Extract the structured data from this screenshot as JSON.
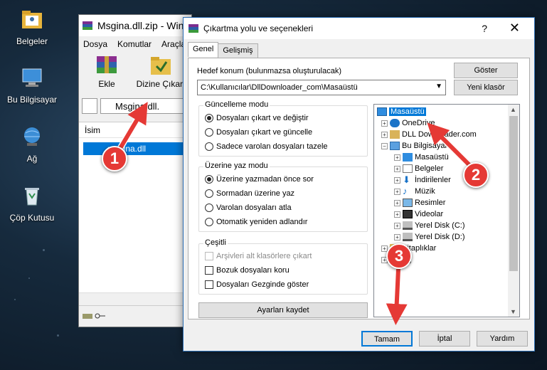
{
  "desktop": {
    "icons": [
      {
        "label": "Belgeler",
        "icon": "folder-documents-icon"
      },
      {
        "label": "Bu Bilgisayar",
        "icon": "computer-icon"
      },
      {
        "label": "Ağ",
        "icon": "network-icon"
      },
      {
        "label": "Çöp Kutusu",
        "icon": "recycle-bin-icon"
      }
    ]
  },
  "winrar": {
    "title": "Msgina.dll.zip - Win",
    "menu": [
      "Dosya",
      "Komutlar",
      "Araçla"
    ],
    "tools": [
      "Ekle",
      "Dizine Çıkart"
    ],
    "address": "Msgina.dll.",
    "column_name": "İsim",
    "file": "msgina.dll"
  },
  "dialog": {
    "title": "Çıkartma yolu ve seçenekleri",
    "help": "?",
    "close": "✕",
    "tabs": [
      "Genel",
      "Gelişmiş"
    ],
    "dest_label": "Hedef konum (bulunmazsa oluşturulacak)",
    "dest_value": "C:\\Kullanıcılar\\DllDownloader_com\\Masaüstü",
    "show_button": "Göster",
    "new_folder_button": "Yeni klasör",
    "update_mode": {
      "title": "Güncelleme modu",
      "options": [
        "Dosyaları çıkart ve değiştir",
        "Dosyaları çıkart ve güncelle",
        "Sadece varolan dosyaları tazele"
      ],
      "selected": 0
    },
    "overwrite_mode": {
      "title": "Üzerine yaz modu",
      "options": [
        "Üzerine yazmadan önce sor",
        "Sormadan üzerine yaz",
        "Varolan dosyaları atla",
        "Otomatik yeniden adlandır"
      ],
      "selected": 0
    },
    "misc": {
      "title": "Çeşitli",
      "options": [
        "Arşivleri alt klasörlere çıkart",
        "Bozuk dosyaları koru",
        "Dosyaları Gezginde göster"
      ]
    },
    "save_settings": "Ayarları kaydet",
    "tree": [
      "Masaüstü",
      "OneDrive",
      "DLL Downloader.com",
      "Bu Bilgisayar",
      "Masaüstü",
      "Belgeler",
      "İndirilenler",
      "Müzik",
      "Resimler",
      "Videolar",
      "Yerel Disk (C:)",
      "Yerel Disk (D:)",
      "Kitaplıklar",
      "Ağ"
    ],
    "ok": "Tamam",
    "cancel": "İptal",
    "help_button": "Yardım"
  },
  "annotations": {
    "step1": "1",
    "step2": "2",
    "step3": "3"
  }
}
